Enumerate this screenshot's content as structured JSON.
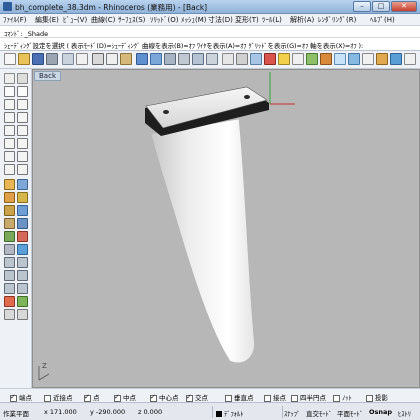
{
  "window": {
    "title": "bh_complete_38.3dm - Rhinoceros (業務用) - [Back]",
    "minimize": "–",
    "maximize": "□",
    "close": "✕"
  },
  "menu": [
    {
      "label": "ﾌｧｲﾙ(F)"
    },
    {
      "label": "編集(E)"
    },
    {
      "label": "ﾋﾞｭｰ(V)"
    },
    {
      "label": "曲線(C)"
    },
    {
      "label": "ｻｰﾌｪｽ(S)"
    },
    {
      "label": "ｿﾘｯﾄﾞ(O)"
    },
    {
      "label": "ﾒｯｼｭ(M)"
    },
    {
      "label": "寸法(D)"
    },
    {
      "label": "変形(T)"
    },
    {
      "label": "ﾂｰﾙ(L)"
    },
    {
      "label": "解析(A)"
    },
    {
      "label": "ﾚﾝﾀﾞﾘﾝｸﾞ(R)"
    },
    {
      "label": "ﾍﾙﾌﾟ(H)"
    }
  ],
  "command": {
    "history": "ｺﾏﾝﾄﾞ: _Shade",
    "prompt": "ｼｪｰﾃﾞｨﾝｸﾞ設定を選択 ( 表示ﾓｰﾄﾞ(D)=ｼｪｰﾃﾞｨﾝｸﾞ 曲線を表示(B)=ｵﾌ ﾜｲﾔを表示(A)=ｵﾌ ｸﾞﾘｯﾄﾞを表示(G)=ｵﾌ 軸を表示(X)=ｵﾌ ):"
  },
  "viewport": {
    "label": "Back",
    "background": "#b7b7b7",
    "axis_label": "Z"
  },
  "osnap": [
    {
      "label": "端点",
      "checked": true
    },
    {
      "label": "近接点",
      "checked": false
    },
    {
      "label": "点",
      "checked": true
    },
    {
      "label": "中点",
      "checked": true
    },
    {
      "label": "中心点",
      "checked": true
    },
    {
      "label": "交点",
      "checked": true
    },
    {
      "label": "垂直点",
      "checked": false
    },
    {
      "label": "接点",
      "checked": false
    },
    {
      "label": "四半円点",
      "checked": false
    },
    {
      "label": "ﾉｯﾄ",
      "checked": false
    },
    {
      "label": "投影",
      "checked": false
    }
  ],
  "status": {
    "cplane": "作業平面",
    "x": "x 171.000",
    "y": "y -290.000",
    "z": "z 0.000",
    "layer": "ﾃﾞﾌｫﾙﾄ",
    "snap": "ｽﾅｯﾌﾟ",
    "ortho": "直交ﾓｰﾄﾞ",
    "planar": "平面ﾓｰﾄﾞ",
    "osnap": "Osnap",
    "history": "ﾋｽﾄﾘ"
  }
}
